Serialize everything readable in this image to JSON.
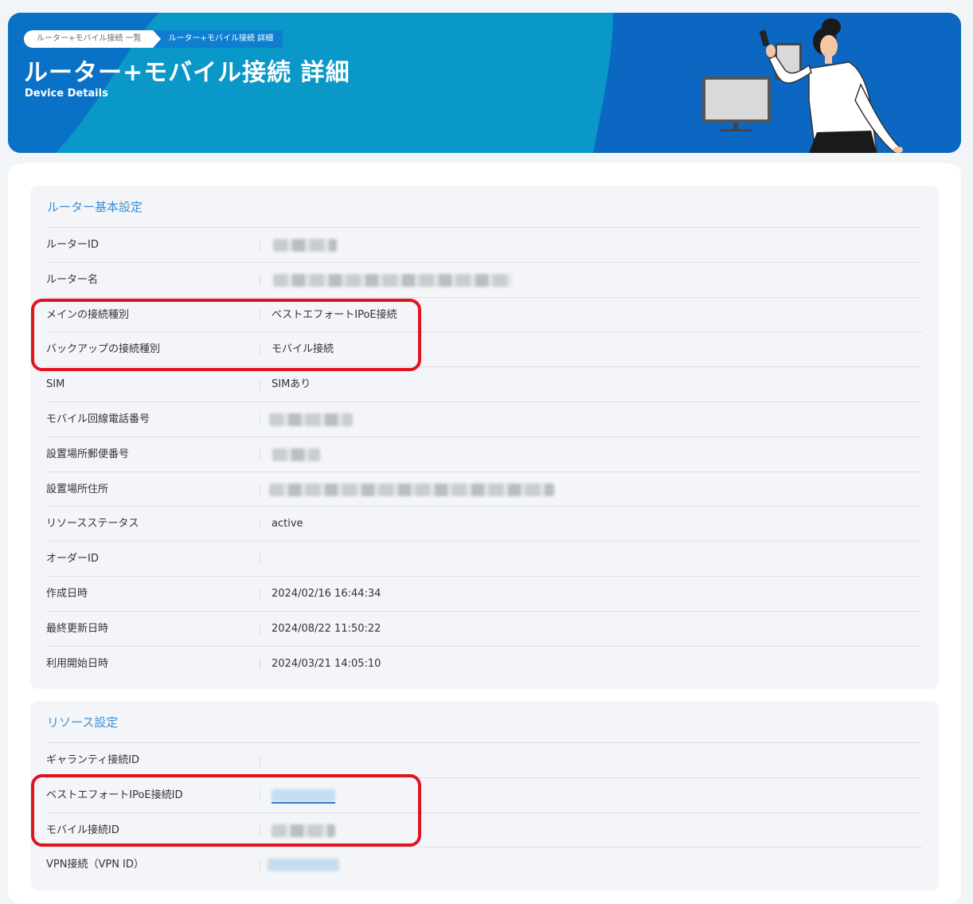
{
  "breadcrumb": {
    "items": [
      {
        "label": "ルーター+モバイル接続 一覧"
      },
      {
        "label": "ルーター+モバイル接続 詳細"
      }
    ]
  },
  "header": {
    "title": "ルーター+モバイル接続 詳細",
    "subtitle": "Device Details"
  },
  "sections": {
    "router_basic": {
      "title": "ルーター基本設定",
      "rows": [
        {
          "label": "ルーターID",
          "value": ""
        },
        {
          "label": "ルーター名",
          "value": ""
        },
        {
          "label": "メインの接続種別",
          "value": "ベストエフォートIPoE接続"
        },
        {
          "label": "バックアップの接続種別",
          "value": "モバイル接続"
        },
        {
          "label": "SIM",
          "value": "SIMあり"
        },
        {
          "label": "モバイル回線電話番号",
          "value": ""
        },
        {
          "label": "設置場所郵便番号",
          "value": ""
        },
        {
          "label": "設置場所住所",
          "value": ""
        },
        {
          "label": "リソースステータス",
          "value": "active"
        },
        {
          "label": "オーダーID",
          "value": ""
        },
        {
          "label": "作成日時",
          "value": "2024/02/16 16:44:34"
        },
        {
          "label": "最終更新日時",
          "value": "2024/08/22 11:50:22"
        },
        {
          "label": "利用開始日時",
          "value": "2024/03/21 14:05:10"
        }
      ]
    },
    "resource": {
      "title": "リソース設定",
      "rows": [
        {
          "label": "ギャランティ接続ID",
          "value": ""
        },
        {
          "label": "ベストエフォートIPoE接続ID",
          "value": ""
        },
        {
          "label": "モバイル接続ID",
          "value": ""
        },
        {
          "label": "VPN接続（VPN ID）",
          "value": ""
        }
      ]
    }
  },
  "colors": {
    "banner_blue": "#0b67c2",
    "banner_teal": "#0a98c8",
    "section_title": "#3b8fd6",
    "highlight_red": "#e0141e",
    "link_blue": "#2f7fd0"
  },
  "icons": {
    "illustration": "woman-with-smartphone-and-monitor-illustration"
  }
}
